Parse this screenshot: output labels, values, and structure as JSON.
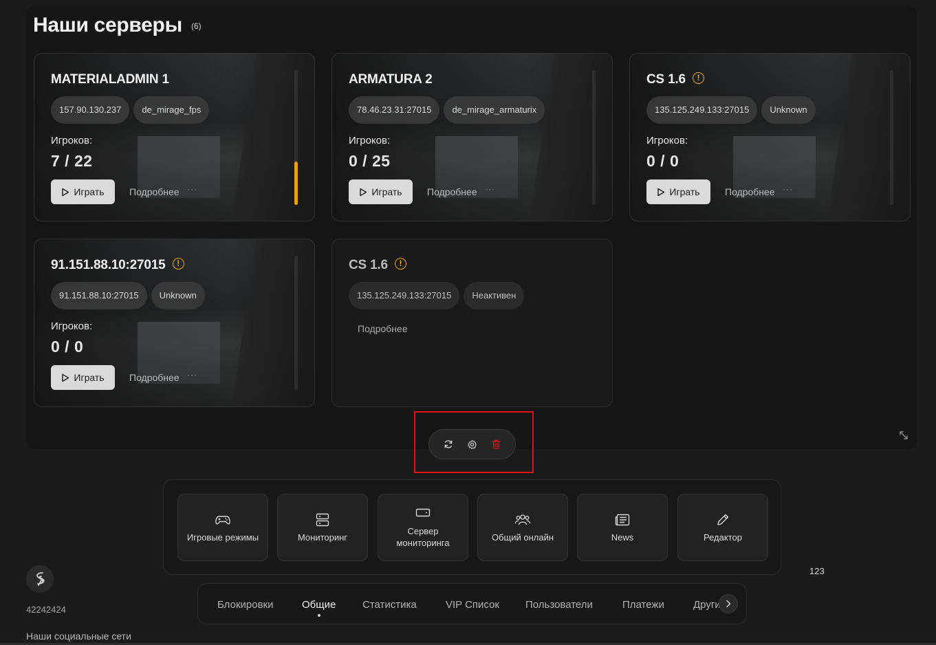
{
  "header": {
    "title": "Наши серверы",
    "count": "(6)"
  },
  "servers": [
    {
      "name": "MATERIALADMIN 1",
      "warning": false,
      "ip": "157.90.130.237",
      "map": "de_mirage_fps",
      "players_label": "Игроков:",
      "players": "7 / 22",
      "play_label": "Играть",
      "more_label": "Подробнее",
      "dots": "···",
      "load": 0.32
    },
    {
      "name": "ARMATURA 2",
      "warning": false,
      "ip": "78.46.23.31:27015",
      "map": "de_mirage_armaturix",
      "players_label": "Игроков:",
      "players": "0 / 25",
      "play_label": "Играть",
      "more_label": "Подробнее",
      "dots": "···"
    },
    {
      "name": "CS 1.6",
      "warning": true,
      "ip": "135.125.249.133:27015",
      "map": "Unknown",
      "players_label": "Игроков:",
      "players": "0 / 0",
      "play_label": "Играть",
      "more_label": "Подробнее",
      "dots": "···"
    },
    {
      "name": "91.151.88.10:27015",
      "warning": true,
      "ip": "91.151.88.10:27015",
      "map": "Unknown",
      "players_label": "Игроков:",
      "players": "0 / 0",
      "play_label": "Играть",
      "more_label": "Подробнее",
      "dots": "···"
    },
    {
      "name": "CS 1.6",
      "warning": true,
      "ip": "135.125.249.133:27015",
      "status": "Неактивен",
      "more_label": "Подробнее"
    }
  ],
  "toolbar": {
    "refresh_icon": "refresh-icon",
    "settings_icon": "gear-icon",
    "delete_icon": "trash-icon",
    "delete_color": "#e01414"
  },
  "nav_tiles": [
    {
      "label": "Игровые режимы",
      "icon": "gamepad-icon"
    },
    {
      "label": "Мониторинг",
      "icon": "server-icon"
    },
    {
      "label": "Сервер мониторинга",
      "icon": "monitor-icon"
    },
    {
      "label": "Общий онлайн",
      "icon": "users-icon"
    },
    {
      "label": "News",
      "icon": "news-icon"
    },
    {
      "label": "Редактор",
      "icon": "pencil-icon"
    }
  ],
  "side_number": "123",
  "footer": {
    "id": "42242424",
    "social": "Наши социальные сети"
  },
  "tabs": [
    {
      "label": "Блокировки",
      "active": false
    },
    {
      "label": "Общие",
      "active": true
    },
    {
      "label": "Статистика",
      "active": false
    },
    {
      "label": "VIP Список",
      "active": false
    },
    {
      "label": "Пользователи",
      "active": false
    },
    {
      "label": "Платежи",
      "active": false
    },
    {
      "label": "Другие",
      "active": false
    }
  ],
  "colors": {
    "accent": "#e8a10a",
    "warning": "#f0a500",
    "highlight": "#e01414"
  }
}
